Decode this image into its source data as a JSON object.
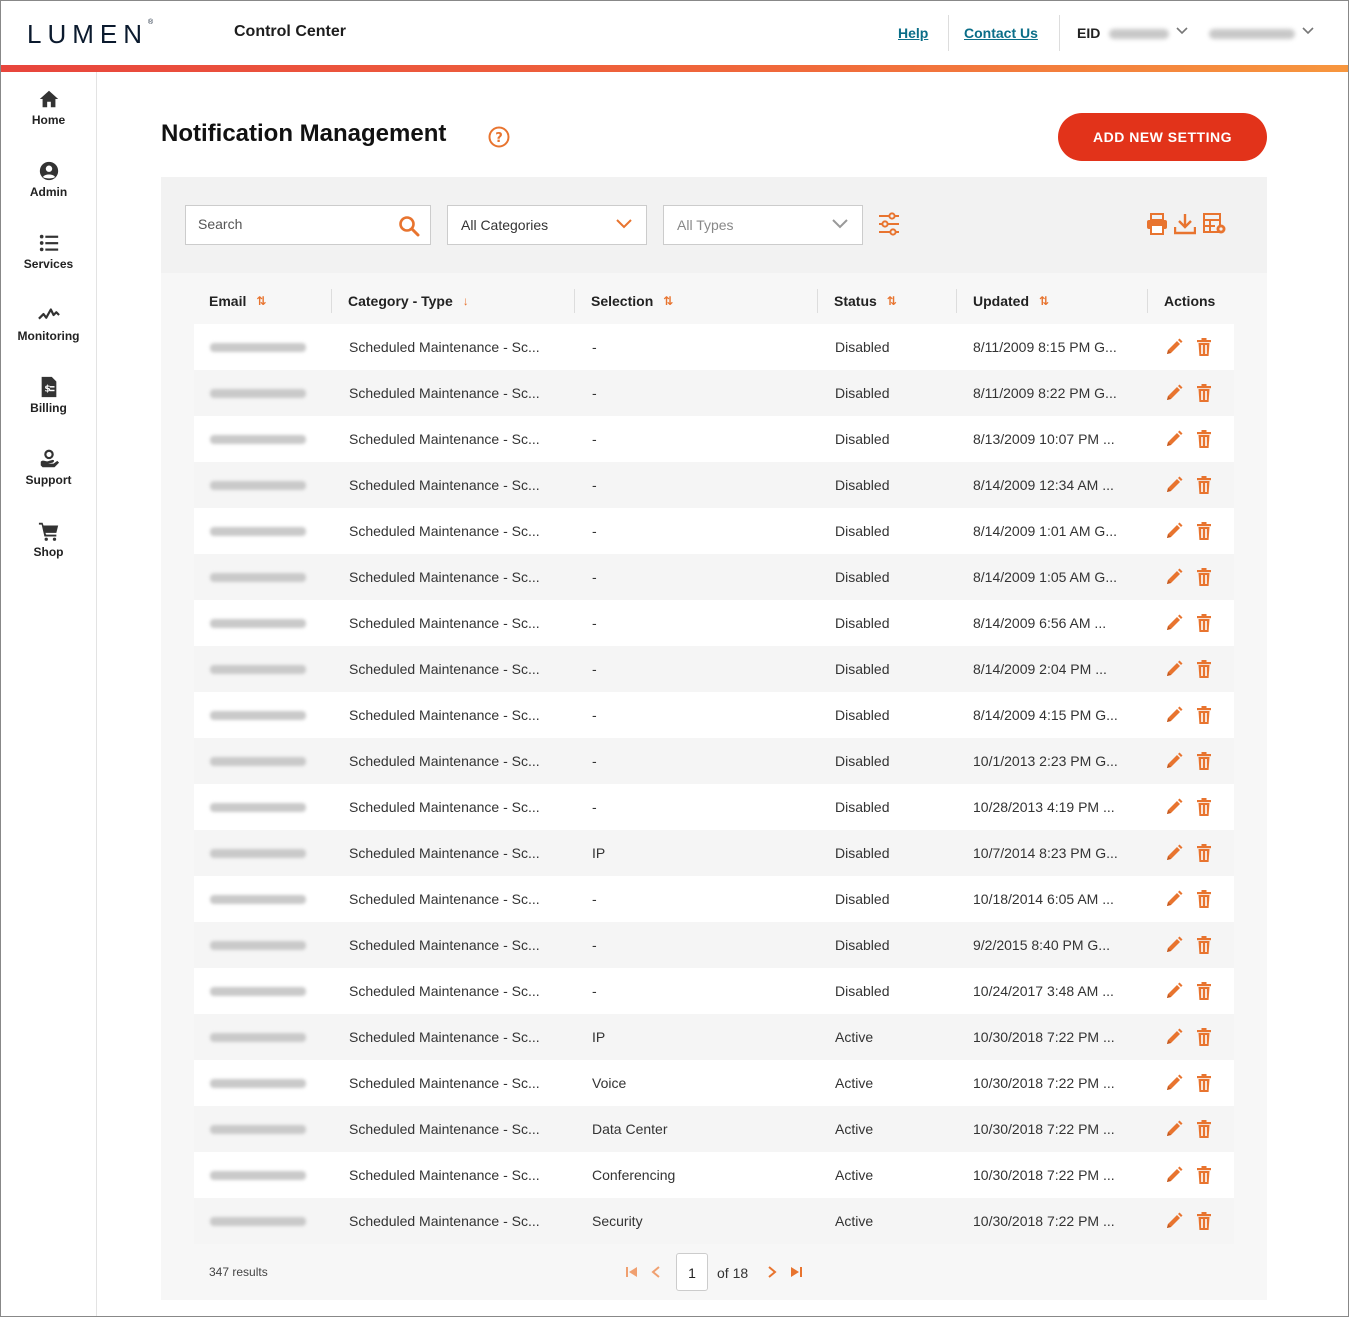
{
  "header": {
    "logo": "LUMEN",
    "app_title": "Control Center",
    "help": "Help",
    "contact": "Contact Us",
    "eid_label": "EID"
  },
  "sidebar": {
    "items": [
      {
        "label": "Home",
        "icon": "home-icon"
      },
      {
        "label": "Admin",
        "icon": "user-icon"
      },
      {
        "label": "Services",
        "icon": "list-icon"
      },
      {
        "label": "Monitoring",
        "icon": "pulse-icon"
      },
      {
        "label": "Billing",
        "icon": "invoice-icon"
      },
      {
        "label": "Support",
        "icon": "support-icon"
      },
      {
        "label": "Shop",
        "icon": "cart-icon"
      }
    ]
  },
  "page": {
    "title": "Notification Management",
    "add_button": "ADD NEW SETTING"
  },
  "toolbar": {
    "search_placeholder": "Search",
    "categories": "All Categories",
    "types": "All Types"
  },
  "colors": {
    "accent": "#e8742f",
    "brand_red": "#e2331a",
    "link": "#0b6e88"
  },
  "table": {
    "columns": [
      "Email",
      "Category - Type",
      "Selection",
      "Status",
      "Updated",
      "Actions"
    ],
    "rows": [
      {
        "category": "Scheduled Maintenance - Sc...",
        "selection": "-",
        "status": "Disabled",
        "updated": "8/11/2009 8:15 PM G..."
      },
      {
        "category": "Scheduled Maintenance - Sc...",
        "selection": "-",
        "status": "Disabled",
        "updated": "8/11/2009 8:22 PM G..."
      },
      {
        "category": "Scheduled Maintenance - Sc...",
        "selection": "-",
        "status": "Disabled",
        "updated": "8/13/2009 10:07 PM ..."
      },
      {
        "category": "Scheduled Maintenance - Sc...",
        "selection": "-",
        "status": "Disabled",
        "updated": "8/14/2009 12:34 AM ..."
      },
      {
        "category": "Scheduled Maintenance - Sc...",
        "selection": "-",
        "status": "Disabled",
        "updated": "8/14/2009 1:01 AM G..."
      },
      {
        "category": "Scheduled Maintenance - Sc...",
        "selection": "-",
        "status": "Disabled",
        "updated": "8/14/2009 1:05 AM G..."
      },
      {
        "category": "Scheduled Maintenance - Sc...",
        "selection": "-",
        "status": "Disabled",
        "updated": "8/14/2009 6:56 AM ..."
      },
      {
        "category": "Scheduled Maintenance - Sc...",
        "selection": "-",
        "status": "Disabled",
        "updated": "8/14/2009 2:04 PM ..."
      },
      {
        "category": "Scheduled Maintenance - Sc...",
        "selection": "-",
        "status": "Disabled",
        "updated": "8/14/2009 4:15 PM G..."
      },
      {
        "category": "Scheduled Maintenance - Sc...",
        "selection": "-",
        "status": "Disabled",
        "updated": "10/1/2013 2:23 PM G..."
      },
      {
        "category": "Scheduled Maintenance - Sc...",
        "selection": "-",
        "status": "Disabled",
        "updated": "10/28/2013 4:19 PM ..."
      },
      {
        "category": "Scheduled Maintenance - Sc...",
        "selection": "IP",
        "status": "Disabled",
        "updated": "10/7/2014 8:23 PM G..."
      },
      {
        "category": "Scheduled Maintenance - Sc...",
        "selection": "-",
        "status": "Disabled",
        "updated": "10/18/2014 6:05 AM ..."
      },
      {
        "category": "Scheduled Maintenance - Sc...",
        "selection": "-",
        "status": "Disabled",
        "updated": "9/2/2015 8:40 PM G..."
      },
      {
        "category": "Scheduled Maintenance - Sc...",
        "selection": "-",
        "status": "Disabled",
        "updated": "10/24/2017 3:48 AM ..."
      },
      {
        "category": "Scheduled Maintenance - Sc...",
        "selection": "IP",
        "status": "Active",
        "updated": "10/30/2018 7:22 PM ..."
      },
      {
        "category": "Scheduled Maintenance - Sc...",
        "selection": "Voice",
        "status": "Active",
        "updated": "10/30/2018 7:22 PM ..."
      },
      {
        "category": "Scheduled Maintenance - Sc...",
        "selection": "Data Center",
        "status": "Active",
        "updated": "10/30/2018 7:22 PM ..."
      },
      {
        "category": "Scheduled Maintenance - Sc...",
        "selection": "Conferencing",
        "status": "Active",
        "updated": "10/30/2018 7:22 PM ..."
      },
      {
        "category": "Scheduled Maintenance - Sc...",
        "selection": "Security",
        "status": "Active",
        "updated": "10/30/2018 7:22 PM ..."
      }
    ]
  },
  "pagination": {
    "results": "347 results",
    "current_page": "1",
    "of_total": "of 18"
  }
}
